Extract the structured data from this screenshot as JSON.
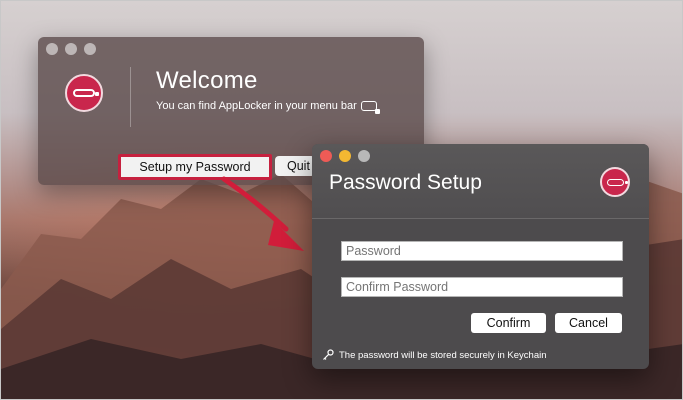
{
  "welcome_window": {
    "title": "Welcome",
    "subtitle": "You can find AppLocker in your menu bar",
    "setup_button": "Setup my Password",
    "quit_button": "Quit"
  },
  "setup_window": {
    "title": "Password Setup",
    "password_placeholder": "Password",
    "confirm_placeholder": "Confirm Password",
    "confirm_button": "Confirm",
    "cancel_button": "Cancel",
    "footnote": "The password will be stored securely in Keychain"
  },
  "colors": {
    "accent": "#c6213f",
    "logo": "#c9264c",
    "window_bg": "#4d4b4d"
  },
  "icons": [
    "applocker-logo-icon",
    "menubar-applocker-icon",
    "key-icon",
    "arrow-icon"
  ]
}
